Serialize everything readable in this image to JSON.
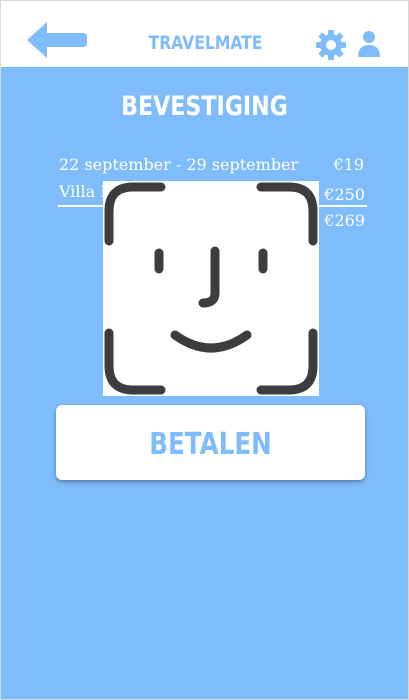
{
  "header": {
    "app_title": "TRAVELMATE",
    "icons": [
      "back-arrow-icon",
      "gear-icon",
      "user-icon"
    ]
  },
  "page": {
    "title": "BEVESTIGING"
  },
  "summary": {
    "dates": "22 september - 29 september",
    "dates_price": "€19",
    "villa_label": "Villa R",
    "villa_price": "€250",
    "total_price": "€269"
  },
  "overlay": {
    "icon": "face-id-icon"
  },
  "actions": {
    "pay_label": "BETALEN"
  },
  "colors": {
    "background": "#7fbcfb",
    "accent": "#7fbcfb",
    "icon_dark": "#3d3d3d",
    "surface": "#ffffff"
  }
}
